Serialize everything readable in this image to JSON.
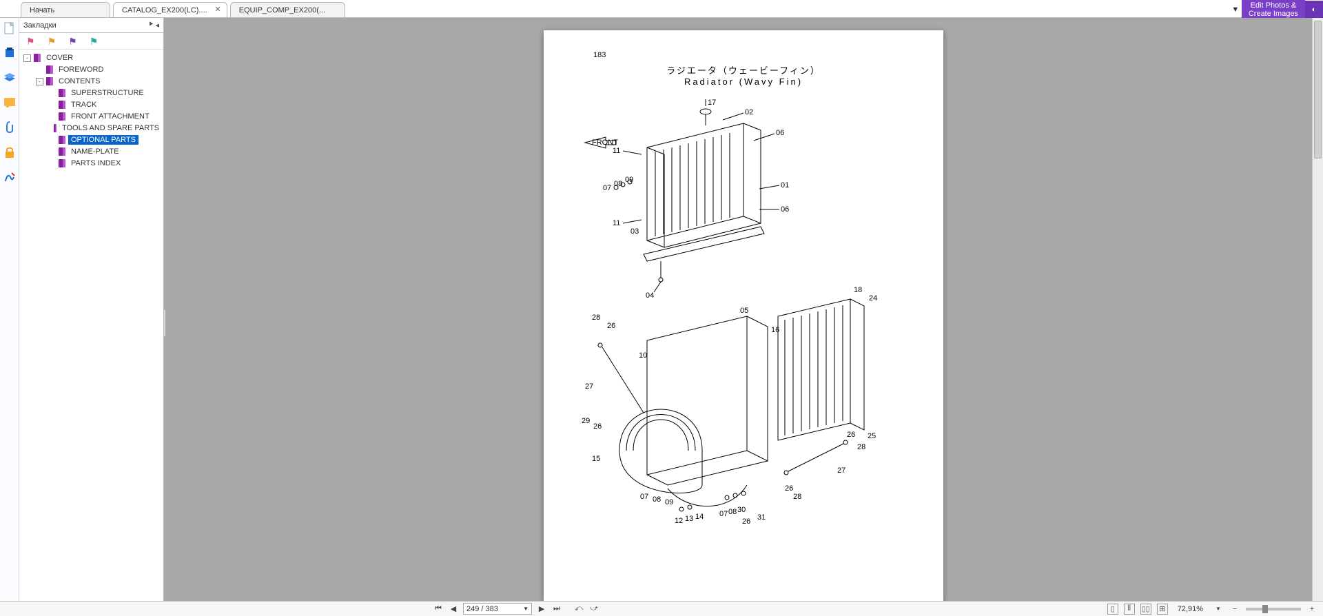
{
  "tabs": [
    {
      "label": "Начать"
    },
    {
      "label": "CATALOG_EX200(LC)....",
      "active": true,
      "closable": true
    },
    {
      "label": "EQUIP_COMP_EX200(..."
    }
  ],
  "ad": {
    "line1": "Edit Photos &",
    "line2": "Create Images"
  },
  "bookmarks": {
    "header": "Закладки",
    "flags": [
      "pink",
      "orange",
      "purple",
      "teal"
    ],
    "tree": [
      {
        "level": 0,
        "label": "COVER",
        "expand": "-"
      },
      {
        "level": 1,
        "label": "FOREWORD"
      },
      {
        "level": 1,
        "label": "CONTENTS",
        "expand": "-"
      },
      {
        "level": 2,
        "label": "SUPERSTRUCTURE"
      },
      {
        "level": 2,
        "label": "TRACK"
      },
      {
        "level": 2,
        "label": "FRONT ATTACHMENT"
      },
      {
        "level": 2,
        "label": "TOOLS AND SPARE PARTS"
      },
      {
        "level": 2,
        "label": "OPTIONAL PARTS",
        "selected": true
      },
      {
        "level": 2,
        "label": "NAME-PLATE"
      },
      {
        "level": 2,
        "label": "PARTS INDEX"
      }
    ]
  },
  "page": {
    "number": "183",
    "title_jp": "ラジエータ（ウェービーフィン）",
    "title_en": "Radiator (Wavy Fin)",
    "callouts": [
      "01",
      "02",
      "03",
      "04",
      "05",
      "06",
      "07",
      "08",
      "09",
      "10",
      "11",
      "12",
      "13",
      "14",
      "15",
      "16",
      "17",
      "18",
      "24",
      "25",
      "26",
      "27",
      "28",
      "29",
      "30",
      "31"
    ],
    "front_label": "FRONT"
  },
  "status": {
    "page_current": "249",
    "page_total": "383",
    "zoom": "72,91%"
  }
}
